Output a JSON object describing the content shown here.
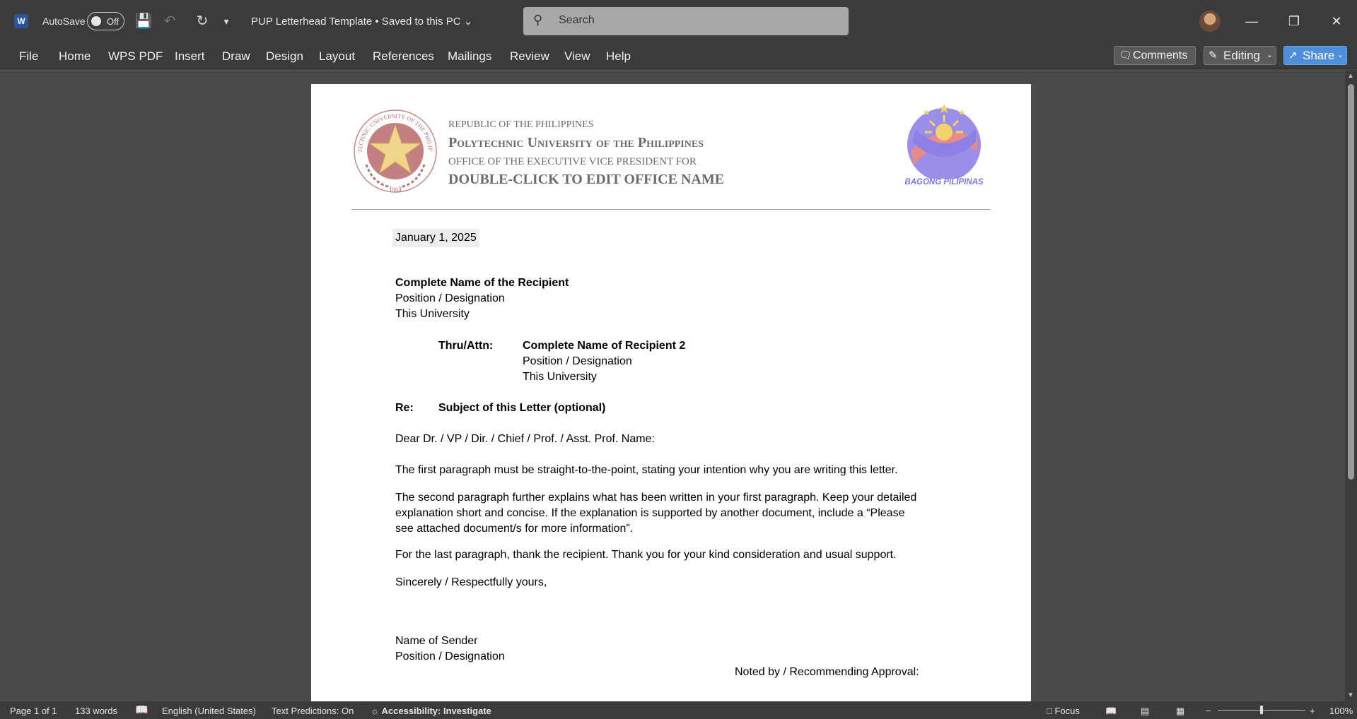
{
  "titlebar": {
    "app_icon": "W",
    "autosave_label": "AutoSave",
    "autosave_state": "Off",
    "doc_title": "PUP Letterhead Template • Saved to this PC",
    "search_placeholder": "Search",
    "icons": [
      "save-icon",
      "undo-icon",
      "redo-icon",
      "customize-quick-access-icon"
    ]
  },
  "menu": {
    "items": [
      "File",
      "Home",
      "WPS PDF",
      "Insert",
      "Draw",
      "Design",
      "Layout",
      "References",
      "Mailings",
      "Review",
      "View",
      "Help"
    ],
    "comments": "Comments",
    "editing": "Editing",
    "share": "Share"
  },
  "letterhead": {
    "line1": "REPUBLIC OF THE PHILIPPINES",
    "line2": "Polytechnic University of the Philippines",
    "line3": "OFFICE OF THE EXECUTIVE VICE PRESIDENT FOR",
    "line4": "DOUBLE-CLICK TO EDIT OFFICE NAME",
    "seal_text": "POLYTECHNIC UNIVERSITY OF THE PHILIPPINES",
    "seal_year": "1904",
    "right_logo_text": "BAGONG PILIPINAS"
  },
  "letter": {
    "date": "January 1, 2025",
    "recipient_name": "Complete Name of the Recipient",
    "recipient_position": "Position / Designation",
    "recipient_org": "This University",
    "thru_label": "Thru/Attn:",
    "thru_name": "Complete Name of Recipient 2",
    "thru_position": "Position / Designation",
    "thru_org": "This University",
    "re_label": "Re:",
    "re_subject": "Subject of this Letter (optional)",
    "salutation": "Dear Dr. / VP / Dir. / Chief / Prof. / Asst. Prof. Name:",
    "para1": "The first paragraph must be straight-to-the-point, stating your intention why you are writing this letter.",
    "para2_l1": "The second paragraph further explains what has been written in your first paragraph.  Keep your detailed",
    "para2_l2": "explanation short and concise.  If the explanation is supported by another document, include a “Please",
    "para2_l3": "see attached document/s for more information”.",
    "para3": "For the last paragraph, thank the recipient.  Thank you for your kind consideration and usual support.",
    "closing": "Sincerely / Respectfully yours,",
    "sender_name": "Name of Sender",
    "sender_position": "Position / Designation",
    "noted_by": "Noted by / Recommending Approval:"
  },
  "status": {
    "page": "Page 1 of 1",
    "words": "133 words",
    "language": "English (United States)",
    "predictions": "Text Predictions: On",
    "accessibility": "Accessibility: Investigate",
    "focus": "Focus",
    "zoom": "100%"
  }
}
